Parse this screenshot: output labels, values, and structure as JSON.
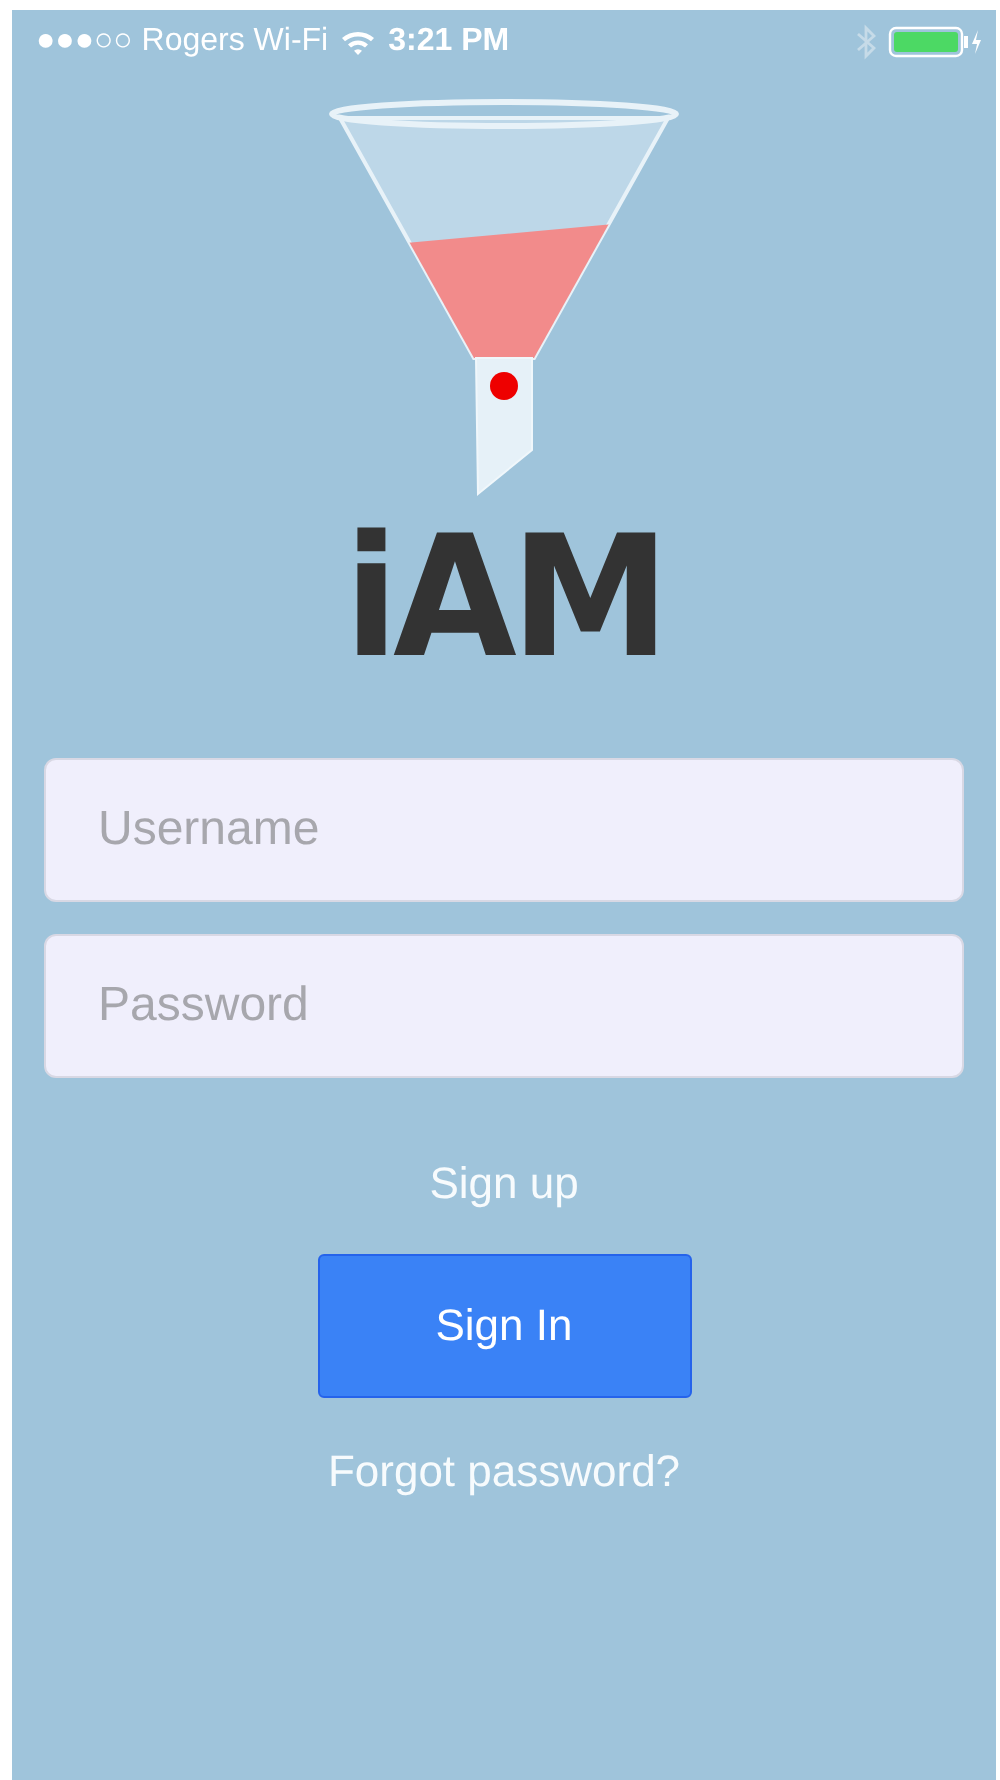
{
  "status_bar": {
    "carrier": "●●●○○ Rogers Wi-Fi",
    "time": "3:21 PM"
  },
  "logo": {
    "text": "iAM"
  },
  "form": {
    "username": {
      "placeholder": "Username"
    },
    "password": {
      "placeholder": "Password"
    }
  },
  "sign_up_link": "Sign up",
  "sign_in_button": "Sign In",
  "forgot_password_link": "Forgot password?"
}
